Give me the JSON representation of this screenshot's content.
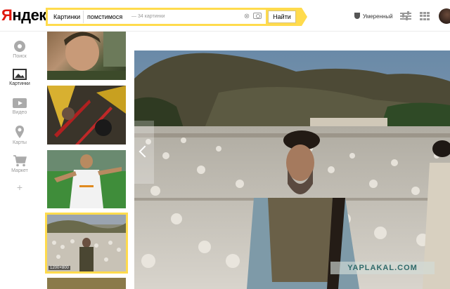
{
  "header": {
    "logo_first": "Я",
    "logo_rest": "ндекс",
    "search_service_chip": "Картинки",
    "search_query": "помстимося",
    "results_count": "— 34 картинки",
    "find_button": "Найти",
    "safe_search_label": "Умеренный",
    "icons": [
      "shield-icon",
      "settings-sliders-icon",
      "apps-grid-icon",
      "camera-icon",
      "clear-icon"
    ]
  },
  "nav": {
    "items": [
      {
        "label": "Поиск",
        "icon": "search-circle-icon",
        "active": false
      },
      {
        "label": "Картинки",
        "icon": "picture-icon",
        "active": true
      },
      {
        "label": "Видео",
        "icon": "video-play-icon",
        "active": false
      },
      {
        "label": "Карты",
        "icon": "map-pin-icon",
        "active": false
      },
      {
        "label": "Маркет",
        "icon": "cart-icon",
        "active": false
      },
      {
        "label": "+",
        "icon": "plus-icon",
        "active": false
      }
    ]
  },
  "thumbnails": {
    "selected_dims": "1200×800"
  },
  "viewer": {
    "watermark": "YAPLAKAL.COM"
  },
  "colors": {
    "accent_yellow": "#ffdb4d",
    "logo_red": "#e0180d"
  }
}
